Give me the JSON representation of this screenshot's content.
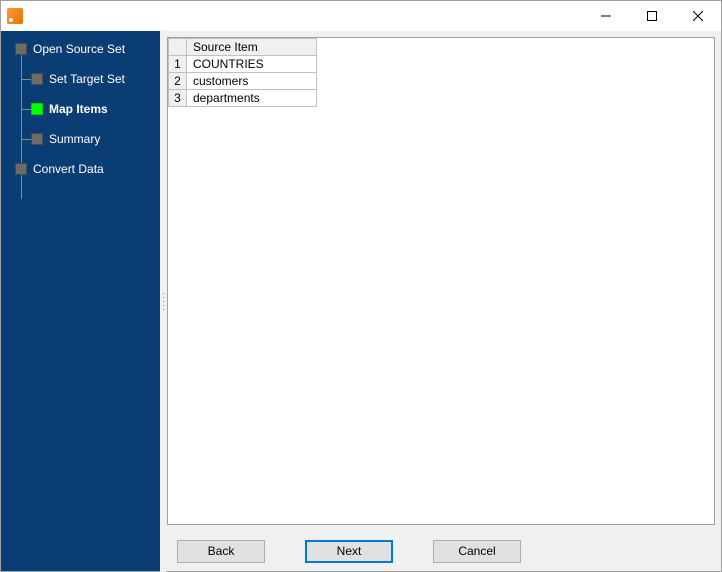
{
  "sidebar": {
    "items": [
      {
        "label": "Open Source Set",
        "active": false,
        "level": 0
      },
      {
        "label": "Set Target Set",
        "active": false,
        "level": 1
      },
      {
        "label": "Map Items",
        "active": true,
        "level": 1
      },
      {
        "label": "Summary",
        "active": false,
        "level": 1
      },
      {
        "label": "Convert Data",
        "active": false,
        "level": 0
      }
    ]
  },
  "table": {
    "header": "Source Item",
    "rows": [
      {
        "n": "1",
        "item": "COUNTRIES"
      },
      {
        "n": "2",
        "item": "customers"
      },
      {
        "n": "3",
        "item": "departments"
      }
    ]
  },
  "buttons": {
    "back": "Back",
    "next": "Next",
    "cancel": "Cancel"
  }
}
